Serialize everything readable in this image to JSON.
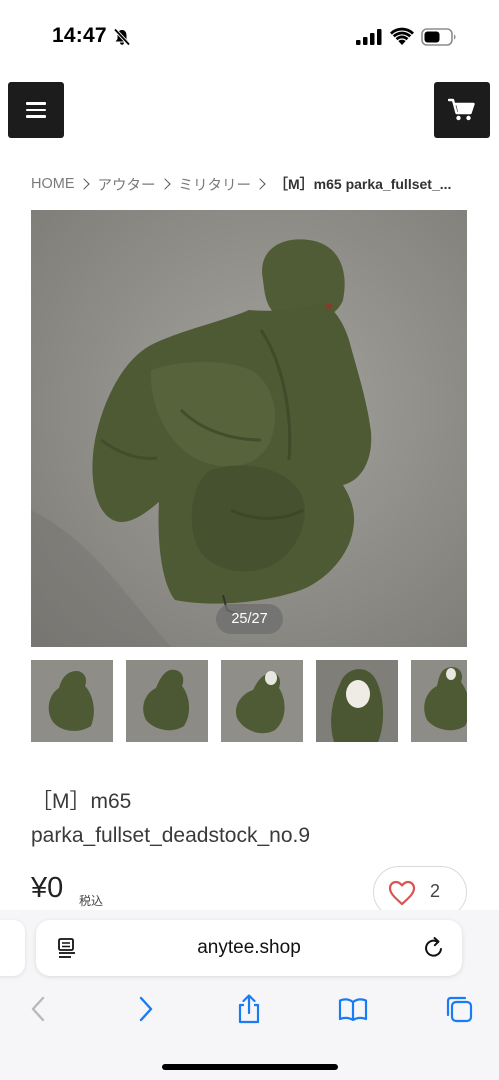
{
  "status_bar": {
    "time": "14:47"
  },
  "header": {
    "menu_icon": "hamburger-menu-icon",
    "cart_icon": "shopping-cart-icon"
  },
  "breadcrumb": {
    "items": [
      "HOME",
      "アウター",
      "ミリタリー"
    ],
    "current": "［M］m65 parka_fullset_..."
  },
  "gallery": {
    "counter": "25/27",
    "main_image": "olive green m65 parka laid flat on concrete floor",
    "thumbnails": [
      "parka-thumb-1",
      "parka-thumb-2",
      "parka-thumb-3",
      "parka-thumb-4",
      "parka-thumb-5"
    ]
  },
  "product": {
    "title_line1": "［M］m65",
    "title_line2": "parka_fullset_deadstock_no.9",
    "price": "¥0",
    "tax_label": "税込",
    "like_count": "2"
  },
  "browser": {
    "url": "anytee.shop",
    "toolbar": [
      "back-icon",
      "forward-icon",
      "share-icon",
      "bookmarks-icon",
      "tabs-icon"
    ]
  },
  "colors": {
    "header_button_bg": "#1c1c1c",
    "heart_red": "#d9534f",
    "link_blue": "#1a7cf5",
    "parka_olive": "#4d5a34"
  }
}
